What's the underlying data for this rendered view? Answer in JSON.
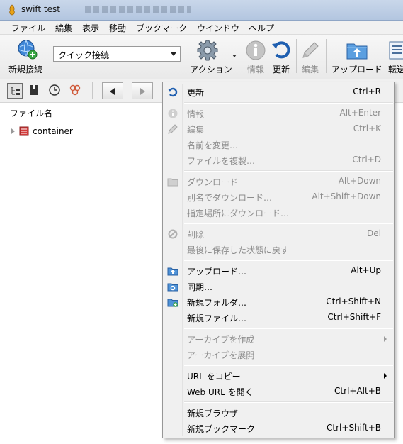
{
  "window": {
    "title": "swift test"
  },
  "menubar": [
    {
      "label": "ファイル"
    },
    {
      "label": "編集"
    },
    {
      "label": "表示"
    },
    {
      "label": "移動"
    },
    {
      "label": "ブックマーク"
    },
    {
      "label": "ウインドウ"
    },
    {
      "label": "ヘルプ"
    }
  ],
  "toolbar": {
    "new_connection": "新規接続",
    "quick_connect": "クイック接続",
    "action": "アクション",
    "info": "情報",
    "refresh": "更新",
    "edit": "編集",
    "upload": "アップロード",
    "transfer": "転送"
  },
  "filelist": {
    "column_filename": "ファイル名",
    "rows": [
      {
        "name": "container"
      }
    ]
  },
  "context_menu": {
    "items": [
      {
        "label": "更新",
        "shortcut": "Ctrl+R",
        "enabled": true,
        "icon": "refresh-icon"
      },
      {
        "label": "情報",
        "shortcut": "Alt+Enter",
        "enabled": false,
        "icon": "info-icon"
      },
      {
        "label": "編集",
        "shortcut": "Ctrl+K",
        "enabled": false,
        "icon": "pencil-icon"
      },
      {
        "label": "名前を変更…",
        "shortcut": "",
        "enabled": false
      },
      {
        "label": "ファイルを複製…",
        "shortcut": "Ctrl+D",
        "enabled": false
      },
      {
        "label": "ダウンロード",
        "shortcut": "Alt+Down",
        "enabled": false,
        "icon": "download-folder-icon"
      },
      {
        "label": "別名でダウンロード…",
        "shortcut": "Alt+Shift+Down",
        "enabled": false
      },
      {
        "label": "指定場所にダウンロード…",
        "shortcut": "",
        "enabled": false
      },
      {
        "label": "削除",
        "shortcut": "Del",
        "enabled": false,
        "icon": "delete-icon"
      },
      {
        "label": "最後に保存した状態に戻す",
        "shortcut": "",
        "enabled": false
      },
      {
        "label": "アップロード…",
        "shortcut": "Alt+Up",
        "enabled": true,
        "icon": "upload-folder-icon"
      },
      {
        "label": "同期…",
        "shortcut": "",
        "enabled": true,
        "icon": "sync-folder-icon"
      },
      {
        "label": "新規フォルダ…",
        "shortcut": "Ctrl+Shift+N",
        "enabled": true,
        "icon": "new-folder-icon"
      },
      {
        "label": "新規ファイル…",
        "shortcut": "Ctrl+Shift+F",
        "enabled": true
      },
      {
        "label": "アーカイブを作成",
        "shortcut": "",
        "enabled": false,
        "submenu": true
      },
      {
        "label": "アーカイブを展開",
        "shortcut": "",
        "enabled": false
      },
      {
        "label": "URL をコピー",
        "shortcut": "",
        "enabled": true,
        "submenu": true
      },
      {
        "label": "Web URL を開く",
        "shortcut": "Ctrl+Alt+B",
        "enabled": true
      },
      {
        "label": "新規ブラウザ",
        "shortcut": "",
        "enabled": true
      },
      {
        "label": "新規ブックマーク",
        "shortcut": "Ctrl+Shift+B",
        "enabled": true
      }
    ]
  },
  "colors": {
    "accent": "#1f6fc5",
    "disabled_text": "#8c8c8c",
    "folder_blue": "#3b86cf"
  }
}
